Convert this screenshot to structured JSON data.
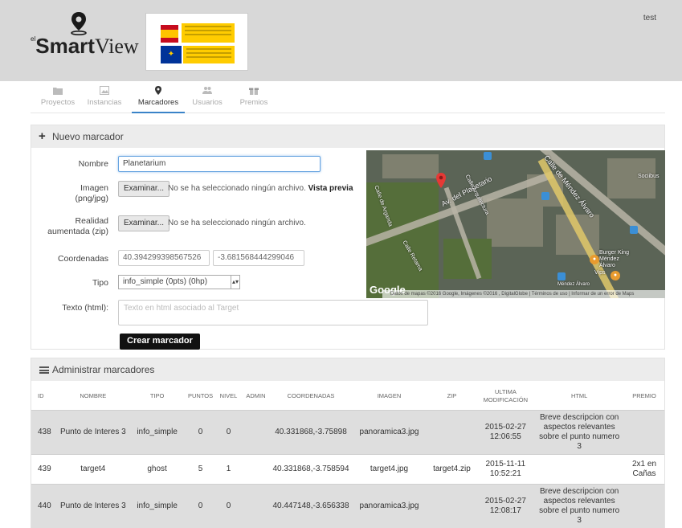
{
  "app": {
    "logo_prefix": "el",
    "logo_bold": "Smart",
    "logo_rest": "View",
    "user": "test"
  },
  "tabs": [
    {
      "label": "Proyectos",
      "icon": "folder-icon",
      "active": false
    },
    {
      "label": "Instancias",
      "icon": "image-icon",
      "active": false
    },
    {
      "label": "Marcadores",
      "icon": "map-pin-icon",
      "active": true
    },
    {
      "label": "Usuarios",
      "icon": "users-icon",
      "active": false
    },
    {
      "label": "Premios",
      "icon": "gift-icon",
      "active": false
    }
  ],
  "form": {
    "title": "Nuevo marcador",
    "nombre_label": "Nombre",
    "nombre_value": "Planetarium",
    "imagen_label": "Imagen (png/jpg)",
    "imagen_button": "Examinar...",
    "imagen_status": "No se ha seleccionado ningún archivo.",
    "imagen_preview": "Vista previa",
    "ra_label": "Realidad aumentada (zip)",
    "ra_button": "Examinar...",
    "ra_status": "No se ha seleccionado ningún archivo.",
    "coord_label": "Coordenadas",
    "lat_value": "40.394299398567526",
    "lng_value": "-3.681568444299046",
    "tipo_label": "Tipo",
    "tipo_value": "info_simple (0pts) (0hp)",
    "texto_label": "Texto (html):",
    "texto_placeholder": "Texto en html asociado al Target",
    "submit_label": "Crear marcador"
  },
  "map": {
    "street_labels": [
      "Av. del Planetario",
      "Calle de Méndez Álvaro",
      "Calle Arquitectura",
      "Calle de Arganda",
      "Calle Retama"
    ],
    "poi_labels": [
      "Burger King Méndez Álvaro",
      "Vips",
      "Sociibus",
      "Méndez Álvaro"
    ],
    "google_logo": "Google",
    "attribution": "Datos de mapas ©2016 Google, Imágenes ©2016 , DigitalGlobe | Términos de uso | Informar de un error de Maps"
  },
  "table": {
    "title": "Administrar marcadores",
    "columns": [
      "ID",
      "NOMBRE",
      "TIPO",
      "PUNTOS",
      "NIVEL",
      "ADMIN",
      "COORDENADAS",
      "IMAGEN",
      "ZIP",
      "ULTIMA MODIFICACIÓN",
      "HTML",
      "PREMIO"
    ],
    "rows": [
      {
        "id": "438",
        "nombre": "Punto de Interes 3",
        "tipo": "info_simple",
        "puntos": "0",
        "nivel": "0",
        "admin": "",
        "coordenadas": "40.331868,-3.75898",
        "imagen": "panoramica3.jpg",
        "zip": "",
        "modificacion": "2015-02-27 12:06:55",
        "html": "Breve descripcion con aspectos relevantes sobre el punto numero 3",
        "premio": ""
      },
      {
        "id": "439",
        "nombre": "target4",
        "tipo": "ghost",
        "puntos": "5",
        "nivel": "1",
        "admin": "",
        "coordenadas": "40.331868,-3.758594",
        "imagen": "target4.jpg",
        "zip": "target4.zip",
        "modificacion": "2015-11-11 10:52:21",
        "html": "",
        "premio": "2x1 en Cañas"
      },
      {
        "id": "440",
        "nombre": "Punto de Interes 3",
        "tipo": "info_simple",
        "puntos": "0",
        "nivel": "0",
        "admin": "",
        "coordenadas": "40.447148,-3.656338",
        "imagen": "panoramica3.jpg",
        "zip": "",
        "modificacion": "2015-02-27 12:08:17",
        "html": "Breve descripcion con aspectos relevantes sobre el punto numero 3",
        "premio": ""
      }
    ]
  },
  "colors": {
    "header_bg": "#d8d8d8",
    "active_tab": "#3a83c8",
    "submit_bg": "#111111",
    "map_pin": "#e53935"
  }
}
